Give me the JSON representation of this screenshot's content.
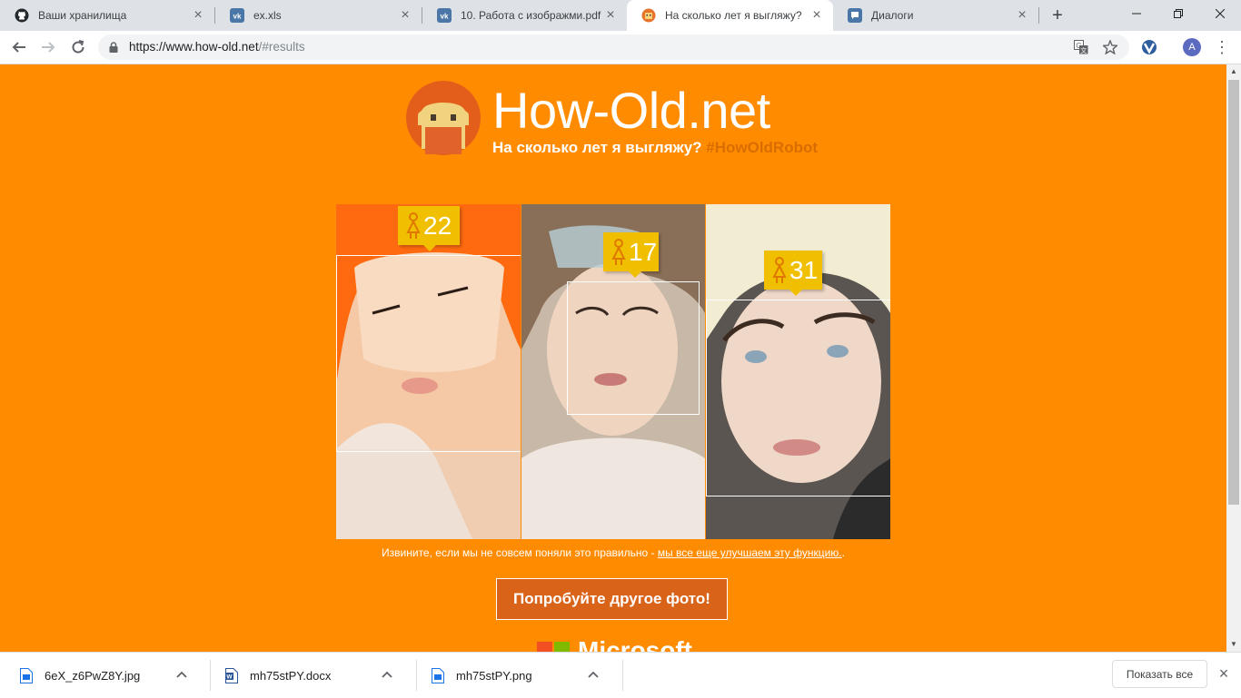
{
  "browser": {
    "tabs": [
      {
        "label": "Ваши хранилища",
        "icon": "github-icon"
      },
      {
        "label": "ex.xls",
        "icon": "vk-icon"
      },
      {
        "label": "10. Работа с изображми.pdf",
        "icon": "vk-icon"
      },
      {
        "label": "На сколько лет я выгляжу?",
        "icon": "how-old-icon",
        "active": true
      },
      {
        "label": "Диалоги",
        "icon": "dialog-icon"
      }
    ],
    "new_tab": "+",
    "url_host": "https://www.how-old.net",
    "url_path": "/#results",
    "profile_initial": "A"
  },
  "page": {
    "title": "How-Old.net",
    "subtitle": "На сколько лет я выгляжу?",
    "hashtag": "#HowOldRobot",
    "faces": [
      {
        "age": "22",
        "gender": "female"
      },
      {
        "age": "17",
        "gender": "female"
      },
      {
        "age": "31",
        "gender": "female"
      }
    ],
    "sorry_text": "Извините, если мы не совсем поняли это правильно - ",
    "sorry_link": "мы все еще улучшаем эту функцию.",
    "sorry_end": ".",
    "try_button": "Попробуйте другое фото!",
    "footer_brand": "Microsoft"
  },
  "downloads": {
    "items": [
      {
        "name": "6eX_z6PwZ8Y.jpg",
        "icon": "image-file-icon"
      },
      {
        "name": "mh75stPY.docx",
        "icon": "word-file-icon"
      },
      {
        "name": "mh75stPY.png",
        "icon": "image-file-icon"
      }
    ],
    "show_all": "Показать все"
  },
  "colors": {
    "page_bg": "#ff8c00",
    "age_tag": "#f0c000",
    "button_bg": "#d96318",
    "hashtag": "#d96d00"
  }
}
